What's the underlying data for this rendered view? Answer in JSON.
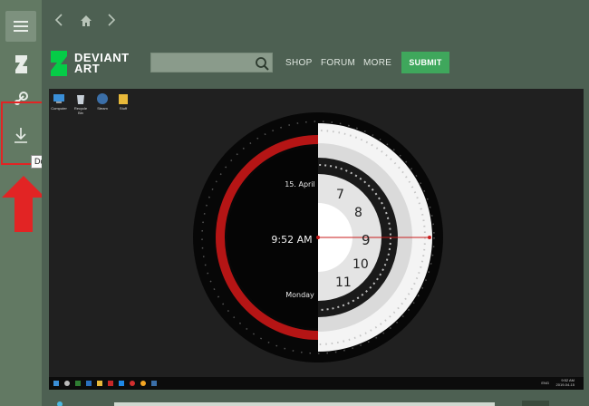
{
  "sidebar": {
    "items": [
      {
        "name": "menu",
        "icon": "hamburger-icon"
      },
      {
        "name": "deviantart",
        "icon": "deviantart-icon"
      },
      {
        "name": "steam",
        "icon": "steam-icon"
      },
      {
        "name": "download",
        "icon": "download-icon"
      }
    ],
    "tooltip": "Download"
  },
  "header": {
    "logo_line1": "DEVIANT",
    "logo_line2": "ART",
    "search_placeholder": "",
    "nav": [
      "SHOP",
      "FORUM",
      "MORE"
    ],
    "submit_label": "SUBMIT"
  },
  "screenshot": {
    "date": "15. April",
    "time": "9:52 AM",
    "day": "Monday",
    "dial_hours": [
      "7",
      "8",
      "9",
      "10",
      "11"
    ],
    "desktop_icons": [
      "Computer",
      "Recycle Bin",
      "Steam",
      "Stuff"
    ],
    "taskbar_time": "9:52 AM",
    "taskbar_date": "2019-04-15",
    "taskbar_lang": "ENG"
  },
  "colors": {
    "sidebar": "#627963",
    "header": "#4d6052",
    "accent_green": "#3fa75c",
    "logo_green": "#05cc47",
    "highlight_red": "#e22424",
    "clock_red": "#b51515"
  }
}
